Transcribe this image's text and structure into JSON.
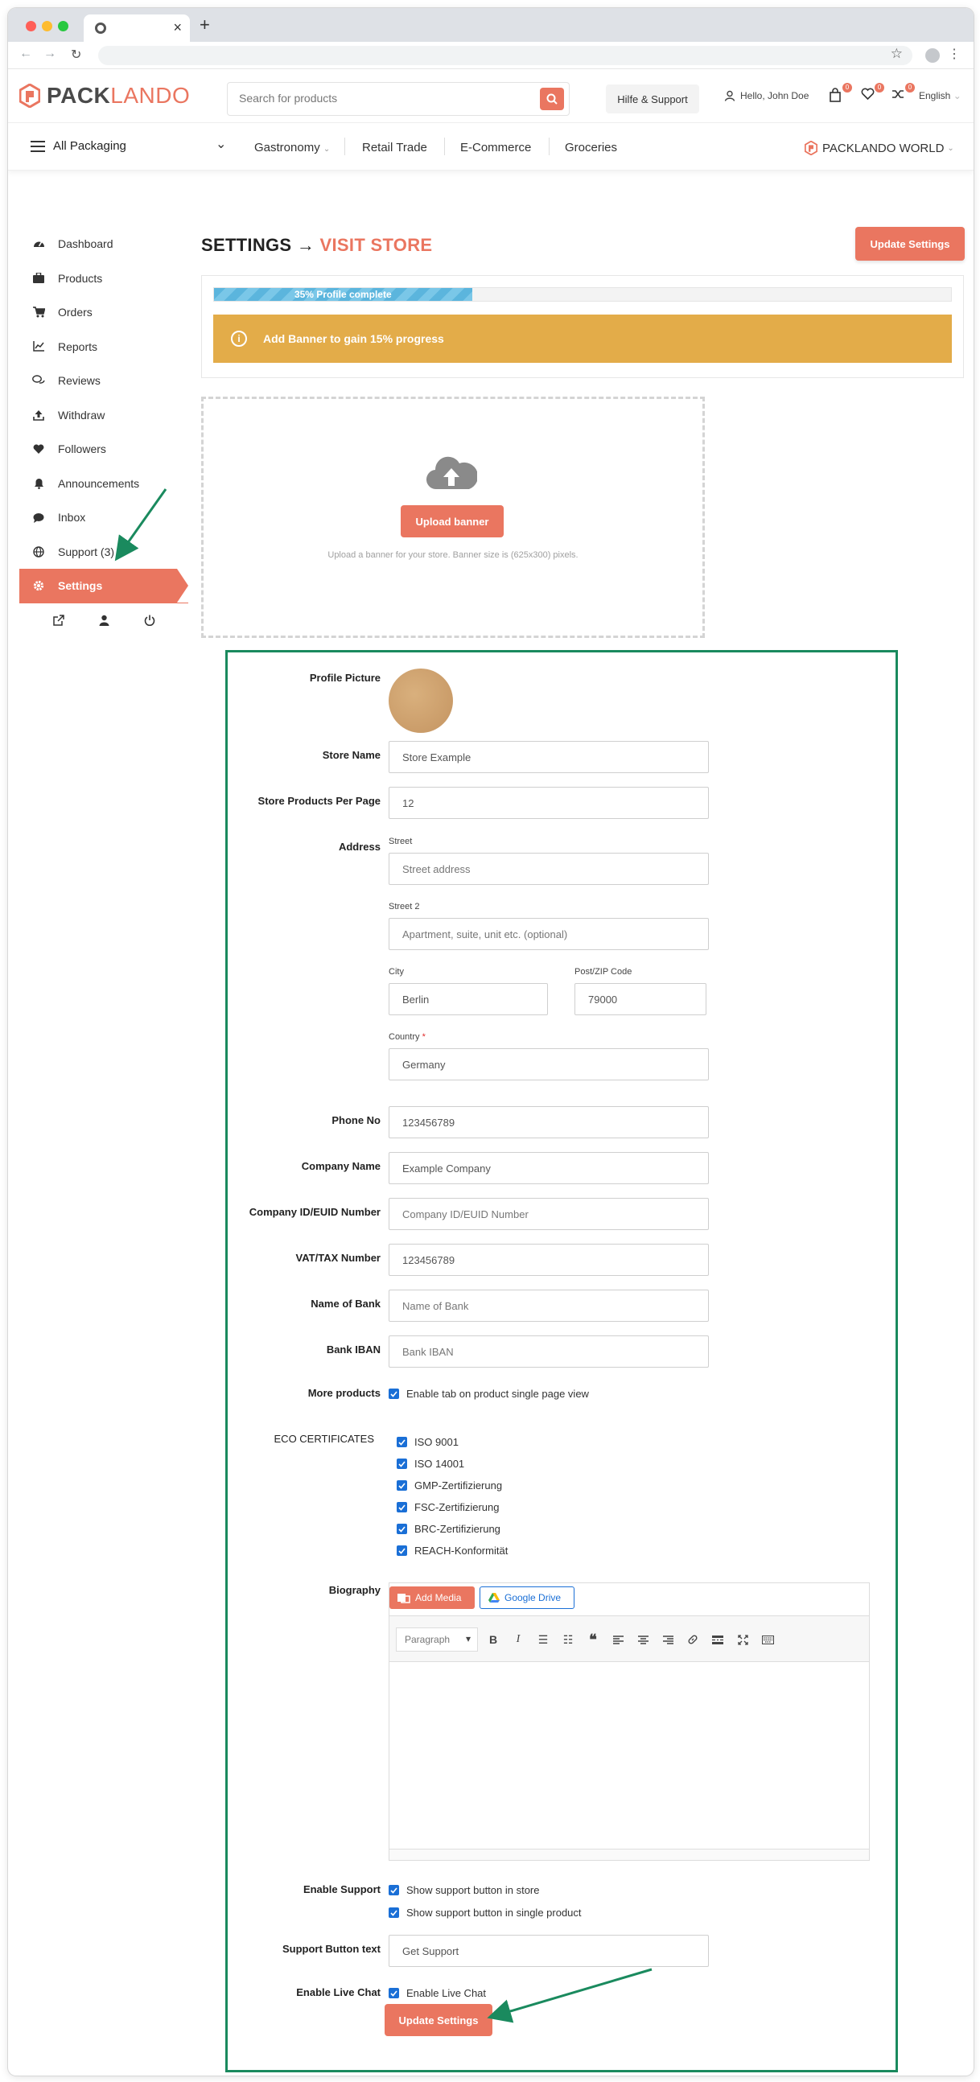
{
  "header": {
    "logo_pack": "PACK",
    "logo_lando": "LANDO",
    "search_placeholder": "Search for products",
    "help_label": "Hilfe & Support",
    "user_greeting": "Hello, John Doe",
    "cart_count": "0",
    "wishlist_count": "0",
    "compare_count": "0",
    "language": "English"
  },
  "nav": {
    "all_packaging": "All Packaging",
    "items": [
      "Gastronomy",
      "Retail Trade",
      "E-Commerce",
      "Groceries"
    ],
    "world": "PACKLANDO WORLD"
  },
  "sidebar": {
    "items": [
      {
        "label": "Dashboard",
        "icon": "dashboard-icon"
      },
      {
        "label": "Products",
        "icon": "briefcase-icon"
      },
      {
        "label": "Orders",
        "icon": "cart-icon"
      },
      {
        "label": "Reports",
        "icon": "chart-icon"
      },
      {
        "label": "Reviews",
        "icon": "comments-icon"
      },
      {
        "label": "Withdraw",
        "icon": "upload-icon"
      },
      {
        "label": "Followers",
        "icon": "heart-icon"
      },
      {
        "label": "Announcements",
        "icon": "bell-icon"
      },
      {
        "label": "Inbox",
        "icon": "chat-icon"
      },
      {
        "label": "Support (3)",
        "icon": "globe-icon"
      },
      {
        "label": "Settings",
        "icon": "gear-icon"
      }
    ],
    "active": "Settings"
  },
  "page": {
    "title_prefix": "SETTINGS →",
    "title_accent": "VISIT STORE",
    "update_label": "Update Settings",
    "progress_text": "35% Profile complete",
    "progress_value": 0.35,
    "alert_text": "Add Banner to gain 15% progress",
    "upload_label": "Upload banner",
    "upload_hint": "Upload a banner for your store. Banner size is (625x300) pixels."
  },
  "form": {
    "profile_picture_label": "Profile Picture",
    "store_name_label": "Store Name",
    "store_name_value": "Store Example",
    "per_page_label": "Store Products Per Page",
    "per_page_value": "12",
    "address_label": "Address",
    "street_label": "Street",
    "street_placeholder": "Street address",
    "street2_label": "Street 2",
    "street2_placeholder": "Apartment, suite, unit etc. (optional)",
    "city_label": "City",
    "city_value": "Berlin",
    "zip_label": "Post/ZIP Code",
    "zip_value": "79000",
    "country_label": "Country",
    "country_required": "*",
    "country_value": "Germany",
    "phone_label": "Phone No",
    "phone_value": "123456789",
    "company_label": "Company Name",
    "company_value": "Example Company",
    "company_id_label": "Company ID/EUID Number",
    "company_id_placeholder": "Company ID/EUID Number",
    "vat_label": "VAT/TAX Number",
    "vat_value": "123456789",
    "bank_label": "Name of Bank",
    "bank_placeholder": "Name of Bank",
    "iban_label": "Bank IBAN",
    "iban_placeholder": "Bank IBAN",
    "more_products_label": "More products",
    "more_products_option": "Enable tab on product single page view",
    "eco_label": "ECO CERTIFICATES",
    "eco_items": [
      "ISO 9001",
      "ISO 14001",
      "GMP-Zertifizierung",
      "FSC-Zertifizierung",
      "BRC-Zertifizierung",
      "REACH-Konformität"
    ],
    "biography_label": "Biography",
    "add_media_label": "Add Media",
    "google_drive_label": "Google Drive",
    "paragraph_label": "Paragraph",
    "enable_support_label": "Enable Support",
    "support_store_option": "Show support button in store",
    "support_product_option": "Show support button in single product",
    "support_text_label": "Support Button text",
    "support_text_value": "Get Support",
    "live_chat_label": "Enable Live Chat",
    "live_chat_option": "Enable Live Chat",
    "update_label": "Update Settings"
  },
  "colors": {
    "accent": "#ea7660",
    "alert": "#e3ac49",
    "progress": "#5bb5dd",
    "annotation": "#1a8a5e",
    "checkbox": "#1a6fd6"
  }
}
